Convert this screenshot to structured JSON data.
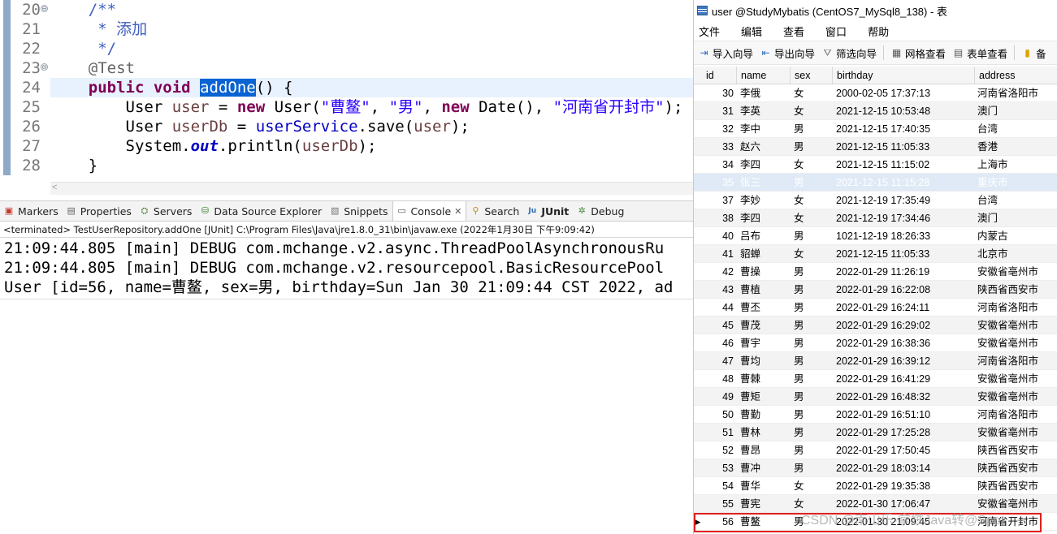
{
  "editor": {
    "lines": [
      {
        "num": "20",
        "fold": "⊖",
        "segments": [
          {
            "t": "    /**",
            "c": "cm"
          }
        ]
      },
      {
        "num": "21",
        "fold": "",
        "segments": [
          {
            "t": "     * 添加",
            "c": "cm"
          }
        ]
      },
      {
        "num": "22",
        "fold": "",
        "segments": [
          {
            "t": "     */",
            "c": "cm"
          }
        ]
      },
      {
        "num": "23",
        "fold": "⊖",
        "segments": [
          {
            "t": "    @Test",
            "c": "an"
          }
        ]
      },
      {
        "num": "24",
        "fold": "",
        "current": true,
        "segments": [
          {
            "t": "    ",
            "c": ""
          },
          {
            "t": "public",
            "c": "kw"
          },
          {
            "t": " ",
            "c": ""
          },
          {
            "t": "void",
            "c": "kw"
          },
          {
            "t": " ",
            "c": ""
          },
          {
            "t": "addOne",
            "c": "sel"
          },
          {
            "t": "() {",
            "c": ""
          }
        ]
      },
      {
        "num": "25",
        "fold": "",
        "segments": [
          {
            "t": "        User ",
            "c": ""
          },
          {
            "t": "user",
            "c": "vr"
          },
          {
            "t": " = ",
            "c": ""
          },
          {
            "t": "new",
            "c": "kw"
          },
          {
            "t": " User(",
            "c": ""
          },
          {
            "t": "\"曹鳌\"",
            "c": "st"
          },
          {
            "t": ", ",
            "c": ""
          },
          {
            "t": "\"男\"",
            "c": "st"
          },
          {
            "t": ", ",
            "c": ""
          },
          {
            "t": "new",
            "c": "kw"
          },
          {
            "t": " Date(), ",
            "c": ""
          },
          {
            "t": "\"河南省开封市\"",
            "c": "st"
          },
          {
            "t": ");",
            "c": ""
          }
        ]
      },
      {
        "num": "26",
        "fold": "",
        "segments": [
          {
            "t": "        User ",
            "c": ""
          },
          {
            "t": "userDb",
            "c": "vr"
          },
          {
            "t": " = ",
            "c": ""
          },
          {
            "t": "userService",
            "c": "fd"
          },
          {
            "t": ".save(",
            "c": ""
          },
          {
            "t": "user",
            "c": "vr"
          },
          {
            "t": ");",
            "c": ""
          }
        ]
      },
      {
        "num": "27",
        "fold": "",
        "segments": [
          {
            "t": "        System.",
            "c": ""
          },
          {
            "t": "out",
            "c": "fd it kw2"
          },
          {
            "t": ".println(",
            "c": ""
          },
          {
            "t": "userDb",
            "c": "vr"
          },
          {
            "t": ");",
            "c": ""
          }
        ]
      },
      {
        "num": "28",
        "fold": "",
        "segments": [
          {
            "t": "    }",
            "c": ""
          }
        ]
      }
    ],
    "hscroll_arrow": "<"
  },
  "tabs": [
    {
      "label": "Markers",
      "icon": "markers-icon",
      "glyph": "▣",
      "color": "#c0392b"
    },
    {
      "label": "Properties",
      "icon": "properties-icon",
      "glyph": "▤",
      "color": "#666666"
    },
    {
      "label": "Servers",
      "icon": "servers-icon",
      "glyph": "⛭",
      "color": "#4a7a2e"
    },
    {
      "label": "Data Source Explorer",
      "icon": "data-source-icon",
      "glyph": "⛁",
      "color": "#3e7d2f"
    },
    {
      "label": "Snippets",
      "icon": "snippets-icon",
      "glyph": "▧",
      "color": "#777777"
    },
    {
      "label": "Console",
      "icon": "console-icon",
      "glyph": "▭",
      "color": "#555555",
      "active": true,
      "close": "✕"
    },
    {
      "label": "Search",
      "icon": "search-icon",
      "glyph": "⚲",
      "color": "#c08a1a"
    },
    {
      "label": "JUnit",
      "icon": "junit-icon",
      "glyph": "Ju",
      "color": "#2b6cb0",
      "bold": true
    },
    {
      "label": "Debug",
      "icon": "debug-icon",
      "glyph": "✲",
      "color": "#4a8a3a"
    }
  ],
  "console": {
    "status": "<terminated> TestUserRepository.addOne [JUnit] C:\\Program Files\\Java\\jre1.8.0_31\\bin\\javaw.exe (2022年1月30日 下午9:09:42)",
    "output": [
      "21:09:44.805 [main] DEBUG com.mchange.v2.async.ThreadPoolAsynchronousRu",
      "21:09:44.805 [main] DEBUG com.mchange.v2.resourcepool.BasicResourcePool",
      "User [id=56, name=曹鳌, sex=男, birthday=Sun Jan 30 21:09:44 CST 2022, ad"
    ]
  },
  "db": {
    "title": "user @StudyMybatis (CentOS7_MySql8_138) - 表",
    "menu": [
      "文件",
      "编辑",
      "查看",
      "窗口",
      "帮助"
    ],
    "toolbar": [
      {
        "label": "导入向导",
        "icon": "import-wizard-icon",
        "glyph": "⇥",
        "color": "#2f6fbf"
      },
      {
        "label": "导出向导",
        "icon": "export-wizard-icon",
        "glyph": "⇤",
        "color": "#2f6fbf"
      },
      {
        "label": "筛选向导",
        "icon": "filter-wizard-icon",
        "glyph": "⛛",
        "color": "#777777"
      },
      {
        "label": "网格查看",
        "icon": "grid-view-icon",
        "glyph": "▦",
        "color": "#555555",
        "sep_before": true
      },
      {
        "label": "表单查看",
        "icon": "form-view-icon",
        "glyph": "▤",
        "color": "#555555"
      },
      {
        "label": "备",
        "icon": "note-icon",
        "glyph": "▮",
        "color": "#e0a000",
        "sep_before": true
      }
    ],
    "columns": [
      "id",
      "name",
      "sex",
      "birthday",
      "address"
    ],
    "rows": [
      [
        "30",
        "李俄",
        "女",
        "2000-02-05 17:37:13",
        "河南省洛阳市"
      ],
      [
        "31",
        "李英",
        "女",
        "2021-12-15 10:53:48",
        "澳门"
      ],
      [
        "32",
        "李中",
        "男",
        "2021-12-15 17:40:35",
        "台湾"
      ],
      [
        "33",
        "赵六",
        "男",
        "2021-12-15 11:05:33",
        "香港"
      ],
      [
        "34",
        "李四",
        "女",
        "2021-12-15 11:15:02",
        "上海市"
      ],
      [
        "35",
        "张三",
        "男",
        "2021-12-15 11:15:28",
        "重庆市"
      ],
      [
        "37",
        "李妙",
        "女",
        "2021-12-19 17:35:49",
        "台湾"
      ],
      [
        "38",
        "李四",
        "女",
        "2021-12-19 17:34:46",
        "澳门"
      ],
      [
        "40",
        "吕布",
        "男",
        "1021-12-19 18:26:33",
        "内蒙古"
      ],
      [
        "41",
        "貂蝉",
        "女",
        "2021-12-15 11:05:33",
        "北京市"
      ],
      [
        "42",
        "曹操",
        "男",
        "2022-01-29 11:26:19",
        "安徽省亳州市"
      ],
      [
        "43",
        "曹植",
        "男",
        "2022-01-29 16:22:08",
        "陕西省西安市"
      ],
      [
        "44",
        "曹丕",
        "男",
        "2022-01-29 16:24:11",
        "河南省洛阳市"
      ],
      [
        "45",
        "曹茂",
        "男",
        "2022-01-29 16:29:02",
        "安徽省亳州市"
      ],
      [
        "46",
        "曹宇",
        "男",
        "2022-01-29 16:38:36",
        "安徽省亳州市"
      ],
      [
        "47",
        "曹均",
        "男",
        "2022-01-29 16:39:12",
        "河南省洛阳市"
      ],
      [
        "48",
        "曹棘",
        "男",
        "2022-01-29 16:41:29",
        "安徽省亳州市"
      ],
      [
        "49",
        "曹矩",
        "男",
        "2022-01-29 16:48:32",
        "安徽省亳州市"
      ],
      [
        "50",
        "曹勤",
        "男",
        "2022-01-29 16:51:10",
        "河南省洛阳市"
      ],
      [
        "51",
        "曹林",
        "男",
        "2022-01-29 17:25:28",
        "安徽省亳州市"
      ],
      [
        "52",
        "曹昂",
        "男",
        "2022-01-29 17:50:45",
        "陕西省西安市"
      ],
      [
        "53",
        "曹冲",
        "男",
        "2022-01-29 18:03:14",
        "陕西省西安市"
      ],
      [
        "54",
        "曹华",
        "女",
        "2022-01-29 19:35:38",
        "陕西省西安市"
      ],
      [
        "55",
        "曹宪",
        "女",
        "2022-01-30 17:06:47",
        "安徽省亳州市"
      ],
      [
        "56",
        "曹鳌",
        "男",
        "2022-01-30 21:09:45",
        "河南省开封市"
      ]
    ],
    "selected_row_index": 5,
    "current_row_index": 24,
    "current_marker": "▶"
  },
  "watermark": "CSDN @南山乐·拿鉄Java转@Spot",
  "colors": {
    "highlight": "#e0201e",
    "selection": "#0a64d2"
  }
}
